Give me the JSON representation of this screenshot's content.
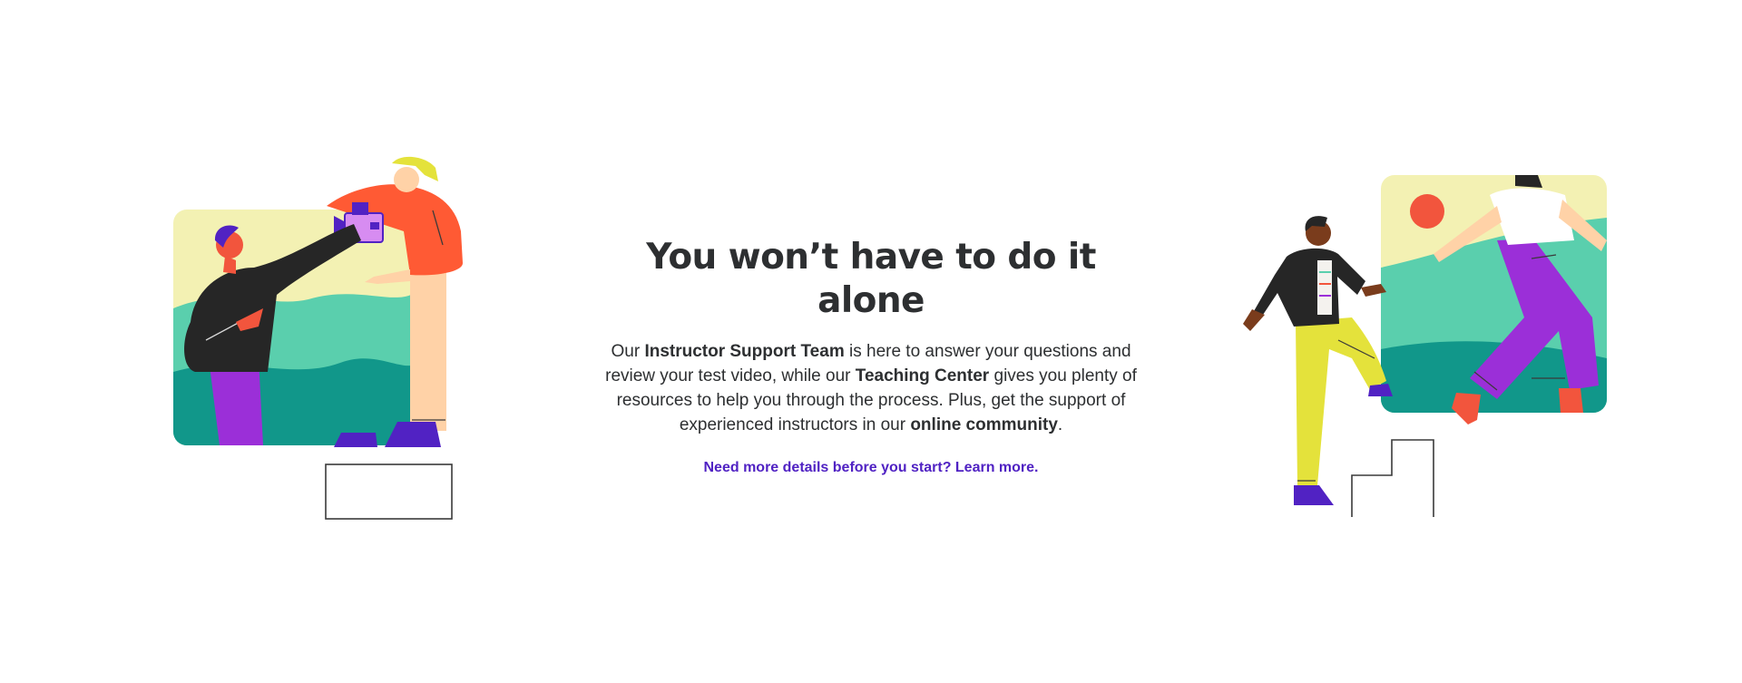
{
  "hero": {
    "title": "You won’t have to do it alone",
    "body": {
      "part1": "Our ",
      "team_strong": "Instructor Support Team",
      "part2": " is here to answer your questions and review your test video, while our ",
      "center_strong": "Teaching Center",
      "part3": " gives you plenty of resources to help you through the process. Plus, get the support of experienced instructors in our ",
      "community_strong": "online community",
      "part4": "."
    },
    "learn_more_link": "Need more details before you start? Learn more."
  },
  "colors": {
    "text": "#2d2f31",
    "link": "#5022c3",
    "sky": "#f3f1b3",
    "hill_light": "#5acfad",
    "hill_dark": "#11978a",
    "sun": "#f2553d",
    "purple": "#9b2fd8",
    "jacket": "#262626",
    "shirt_orange": "#ff5a34",
    "pants_cream": "#ffd2a7",
    "pants_yellow": "#e4e23b",
    "shoe_indigo": "#5122c3"
  },
  "illustrations": {
    "left": {
      "icon": "video-recording-scene-illustration"
    },
    "right": {
      "icon": "climbing-steps-help-illustration"
    }
  }
}
